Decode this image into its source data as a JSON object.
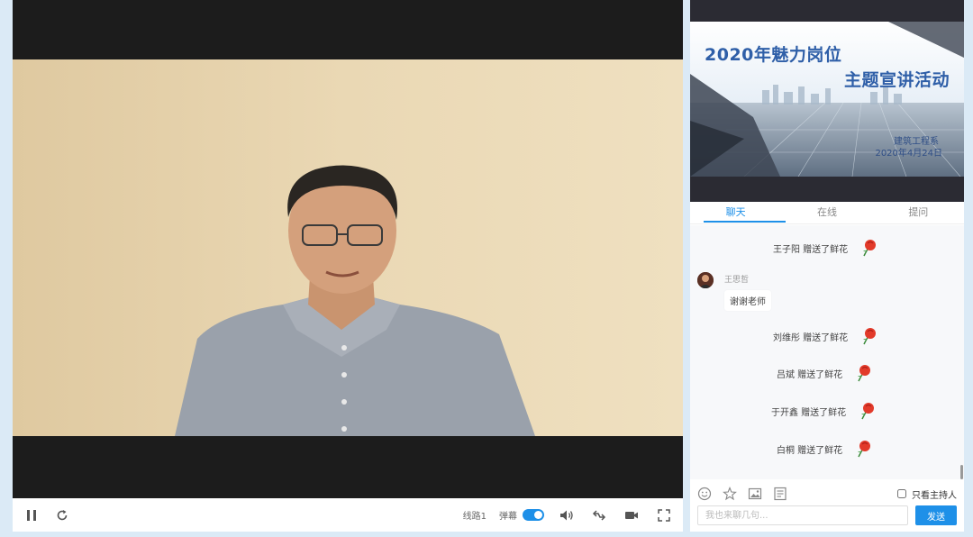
{
  "player": {
    "line_label": "线路1",
    "danmaku_label": "弹幕",
    "danmaku_enabled": true
  },
  "slide": {
    "title_line1": "2020年魅力岗位",
    "title_line2": "主题宣讲活动",
    "subtitle_line1": "建筑工程系",
    "subtitle_line2": "2020年4月24日"
  },
  "tabs": [
    {
      "label": "聊天",
      "active": true
    },
    {
      "label": "在线",
      "active": false
    },
    {
      "label": "提问",
      "active": false
    }
  ],
  "chat": {
    "gifts_top": [
      {
        "text": "王子阳 赠送了鲜花"
      }
    ],
    "message": {
      "name": "王思哲",
      "text": "谢谢老师"
    },
    "gifts_bottom": [
      {
        "text": "刘维彤 赠送了鲜花"
      },
      {
        "text": "吕斌 赠送了鲜花"
      },
      {
        "text": "于开鑫 赠送了鲜花"
      },
      {
        "text": "白桐 赠送了鲜花"
      }
    ]
  },
  "toolbar": {
    "host_only_label": "只看主持人",
    "host_only_checked": false
  },
  "composer": {
    "placeholder": "我也来聊几句...",
    "send_label": "发送"
  },
  "colors": {
    "accent": "#1e90e8",
    "page_bg": "#dbeaf6",
    "player_bg": "#1c1c1c"
  }
}
